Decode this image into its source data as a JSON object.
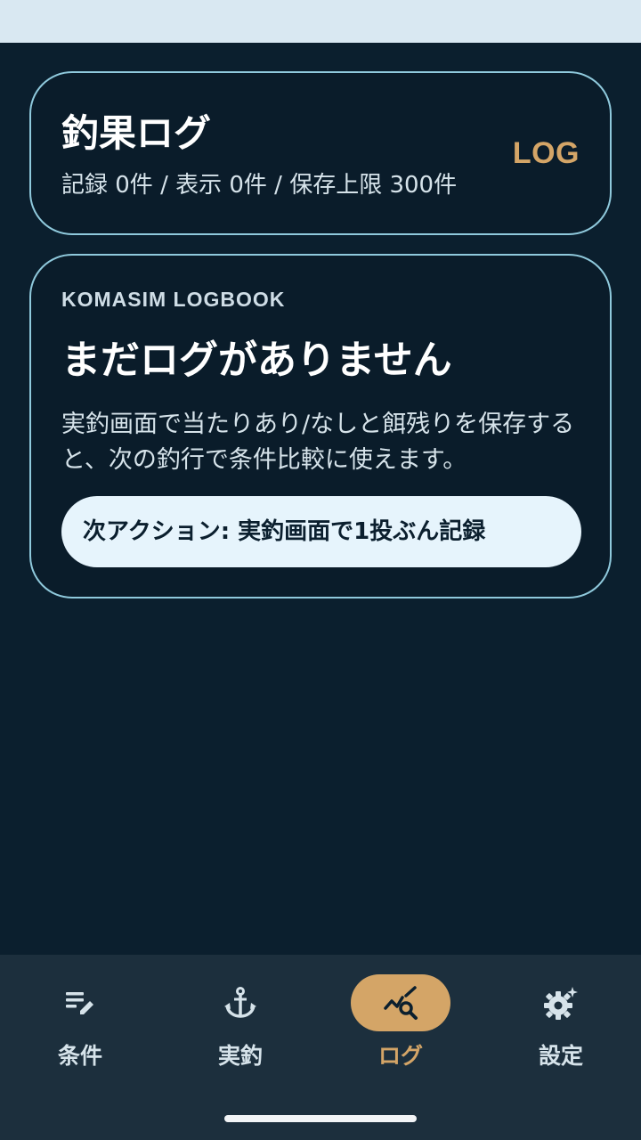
{
  "header": {
    "title": "釣果ログ",
    "subtitle": "記録 0件 / 表示 0件 / 保存上限 300件",
    "badge": "LOG"
  },
  "empty_state": {
    "eyebrow": "KOMASIM LOGBOOK",
    "heading": "まだログがありません",
    "description": "実釣画面で当たりあり/なしと餌残りを保存すると、次の釣行で条件比較に使えます。",
    "action_label": "次アクション: 実釣画面で1投ぶん記録"
  },
  "bottom_nav": {
    "items": [
      {
        "label": "条件",
        "icon": "edit-list-icon",
        "active": false
      },
      {
        "label": "実釣",
        "icon": "anchor-icon",
        "active": false
      },
      {
        "label": "ログ",
        "icon": "chart-search-icon",
        "active": true
      },
      {
        "label": "設定",
        "icon": "gear-sparkle-icon",
        "active": false
      }
    ]
  },
  "colors": {
    "background": "#0b1f2e",
    "card_border": "#8fc9dc",
    "accent": "#d4a567",
    "pill_background": "#e6f4fc",
    "nav_background": "#1c2f3d",
    "status_bar": "#d9e8f2"
  }
}
